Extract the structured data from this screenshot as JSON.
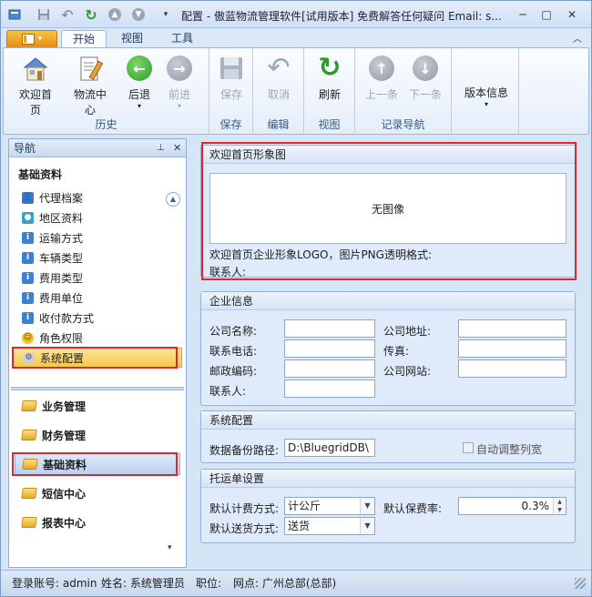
{
  "title": "配置 - 傲蓝物流管理软件[试用版本] 免费解答任何疑问 Email: s...",
  "tabs": [
    "开始",
    "视图",
    "工具"
  ],
  "ribbon": {
    "groups": [
      {
        "label": "历史",
        "buttons": [
          "欢迎首页",
          "物流中心",
          "后退",
          "前进"
        ]
      },
      {
        "label": "保存",
        "buttons": [
          "保存"
        ]
      },
      {
        "label": "编辑",
        "buttons": [
          "取消"
        ]
      },
      {
        "label": "视图",
        "buttons": [
          "刷新"
        ]
      },
      {
        "label": "记录导航",
        "buttons": [
          "上一条",
          "下一条"
        ]
      },
      {
        "label": "",
        "buttons": [
          "版本信息"
        ]
      }
    ]
  },
  "nav": {
    "header": "导航",
    "pin": "⊥",
    "close": "✕",
    "section": "基础资料",
    "items": [
      "代理档案",
      "地区资料",
      "运输方式",
      "车辆类型",
      "费用类型",
      "费用单位",
      "收付款方式",
      "角色权限",
      "系统配置"
    ],
    "groups": [
      "业务管理",
      "财务管理",
      "基础资料",
      "短信中心",
      "报表中心"
    ]
  },
  "welcome": {
    "header": "欢迎首页形象图",
    "no_image": "无图像",
    "logo_note": "欢迎首页企业形象LOGO，图片PNG透明格式:",
    "contact_label": "联系人:"
  },
  "company": {
    "header": "企业信息",
    "name_label": "公司名称:",
    "address_label": "公司地址:",
    "phone_label": "联系电话:",
    "fax_label": "传真:",
    "zip_label": "邮政编码:",
    "website_label": "公司网站:",
    "contact_label": "联系人:"
  },
  "sysconfig": {
    "header": "系统配置",
    "backup_label": "数据备份路径:",
    "backup_value": "D:\\BluegridDB\\",
    "auto_col_label": "自动调整列宽"
  },
  "consign": {
    "header": "托运单设置",
    "billing_label": "默认计费方式:",
    "billing_value": "计公斤",
    "insure_label": "默认保费率:",
    "insure_value": "0.3%",
    "delivery_label": "默认送货方式:",
    "delivery_value": "送货"
  },
  "status": {
    "account_label": "登录账号:",
    "account": "admin",
    "name_label": "姓名:",
    "name": "系统管理员",
    "post_label": "职位:",
    "site_label": "网点:",
    "site": "广州总部(总部)"
  }
}
